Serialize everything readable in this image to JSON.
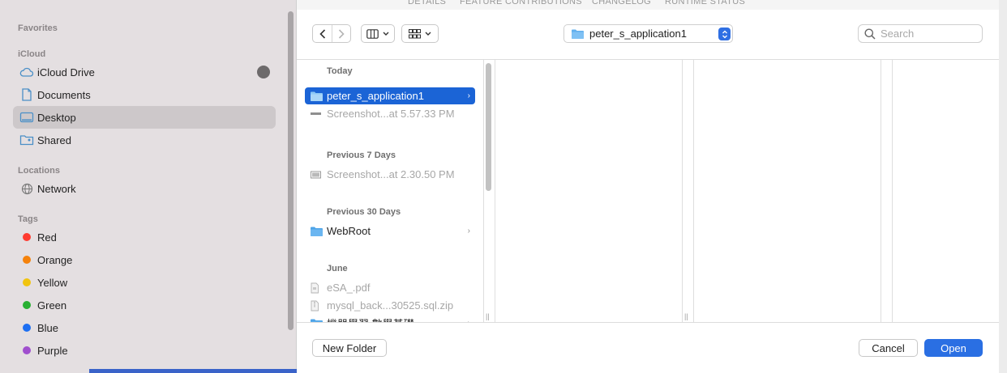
{
  "background_app": {
    "tabs": [
      "DETAILS",
      "FEATURE CONTRIBUTIONS",
      "CHANGELOG",
      "RUNTIME STATUS"
    ]
  },
  "sidebar": {
    "favorites_title": "Favorites",
    "icloud_title": "iCloud",
    "icloud_items": [
      {
        "label": "iCloud Drive",
        "icon": "cloud-icon"
      },
      {
        "label": "Documents",
        "icon": "document-icon"
      },
      {
        "label": "Desktop",
        "icon": "desktop-icon",
        "selected": true
      },
      {
        "label": "Shared",
        "icon": "shared-folder-icon"
      }
    ],
    "locations_title": "Locations",
    "locations_items": [
      {
        "label": "Network",
        "icon": "globe-icon"
      }
    ],
    "tags_title": "Tags",
    "tags": [
      {
        "label": "Red",
        "color": "#ff3b30"
      },
      {
        "label": "Orange",
        "color": "#f5820b"
      },
      {
        "label": "Yellow",
        "color": "#f1c40f"
      },
      {
        "label": "Green",
        "color": "#28b032"
      },
      {
        "label": "Blue",
        "color": "#1d6ff2"
      },
      {
        "label": "Purple",
        "color": "#a04fce"
      }
    ]
  },
  "toolbar": {
    "path_label": "peter_s_application1",
    "search_placeholder": "Search"
  },
  "browser": {
    "groups": [
      {
        "title": "Today"
      },
      {
        "title": "Previous 7 Days"
      },
      {
        "title": "Previous 30 Days"
      },
      {
        "title": "June"
      }
    ],
    "rows": [
      {
        "label": "peter_s_application1",
        "type": "folder",
        "selected": true,
        "chevron": "›"
      },
      {
        "label": "Screenshot...at 5.57.33 PM",
        "type": "image",
        "dim": true
      },
      {
        "label": "Screenshot...at 2.30.50 PM",
        "type": "image",
        "dim": true
      },
      {
        "label": "WebRoot",
        "type": "folder",
        "chevron": "›"
      },
      {
        "label": "eSA_.pdf",
        "type": "pdf",
        "dim": true
      },
      {
        "label": "mysql_back...30525.sql.zip",
        "type": "zip",
        "dim": true
      },
      {
        "label": "機器學習 數學基礎",
        "type": "folder",
        "chevron": "›"
      }
    ]
  },
  "footer": {
    "new_folder": "New Folder",
    "cancel": "Cancel",
    "open": "Open"
  },
  "colors": {
    "accent": "#2a6fe3",
    "selection": "#1b64d6",
    "sidebar_bg": "#e4dfe1"
  }
}
